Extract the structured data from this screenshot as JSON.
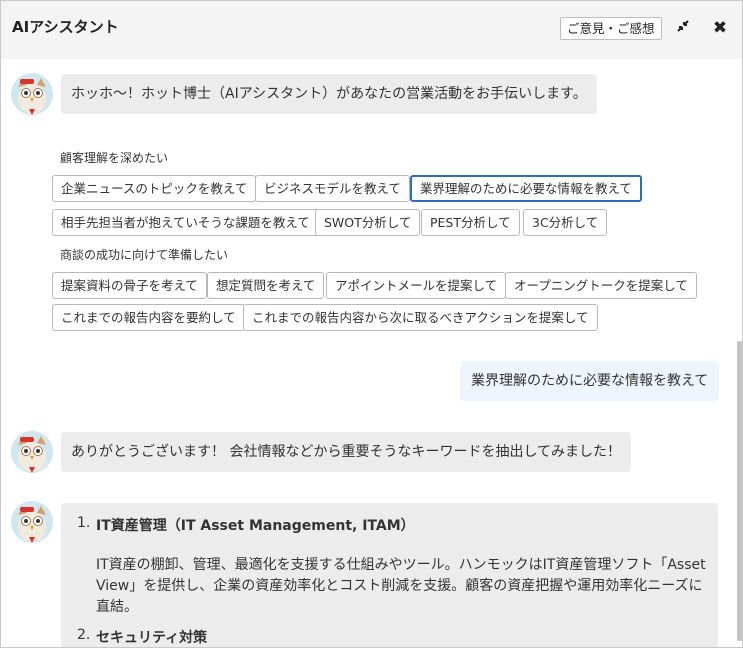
{
  "window": {
    "title": "AIアシスタント",
    "feedback_label": "ご意見・ご感想",
    "shrink_icon": "shrink-icon",
    "close_icon": "close-icon"
  },
  "messages": {
    "greeting": "ホッホ～！ホット博士（AIアシスタント）があなたの営業活動をお手伝いします。",
    "user_query": "業界理解のために必要な情報を教えて",
    "reply": "ありがとうございます！ 会社情報などから重要そうなキーワードを抽出してみました！"
  },
  "suggestions": {
    "section1_label": "顧客理解を深めたい",
    "section1_chips": [
      "企業ニュースのトピックを教えて",
      "ビジネスモデルを教えて",
      "業界理解のために必要な情報を教えて",
      "相手先担当者が抱えていそうな課題を教えて",
      "SWOT分析して",
      "PEST分析して",
      "3C分析して"
    ],
    "section2_label": "商談の成功に向けて準備したい",
    "section2_chips": [
      "提案資料の骨子を考えて",
      "想定質問を考えて",
      "アポイントメールを提案して",
      "オープニングトークを提案して",
      "これまでの報告内容を要約して",
      "これまでの報告内容から次に取るべきアクションを提案して"
    ]
  },
  "keywords": [
    {
      "number": "1.",
      "title": "IT資産管理（IT Asset Management, ITAM）",
      "desc_line1": "IT資産の棚卸、管理、最適化を支援する仕組みやツール。ハンモックはIT資産管理ソフト「Asset",
      "desc_line2": "View」を提供し、企業の資産効率化とコスト削減を支援。顧客の資産把握や運用効率化ニーズに",
      "desc_line3": "直結。"
    },
    {
      "number": "2.",
      "title": "セキュリティ対策"
    }
  ]
}
